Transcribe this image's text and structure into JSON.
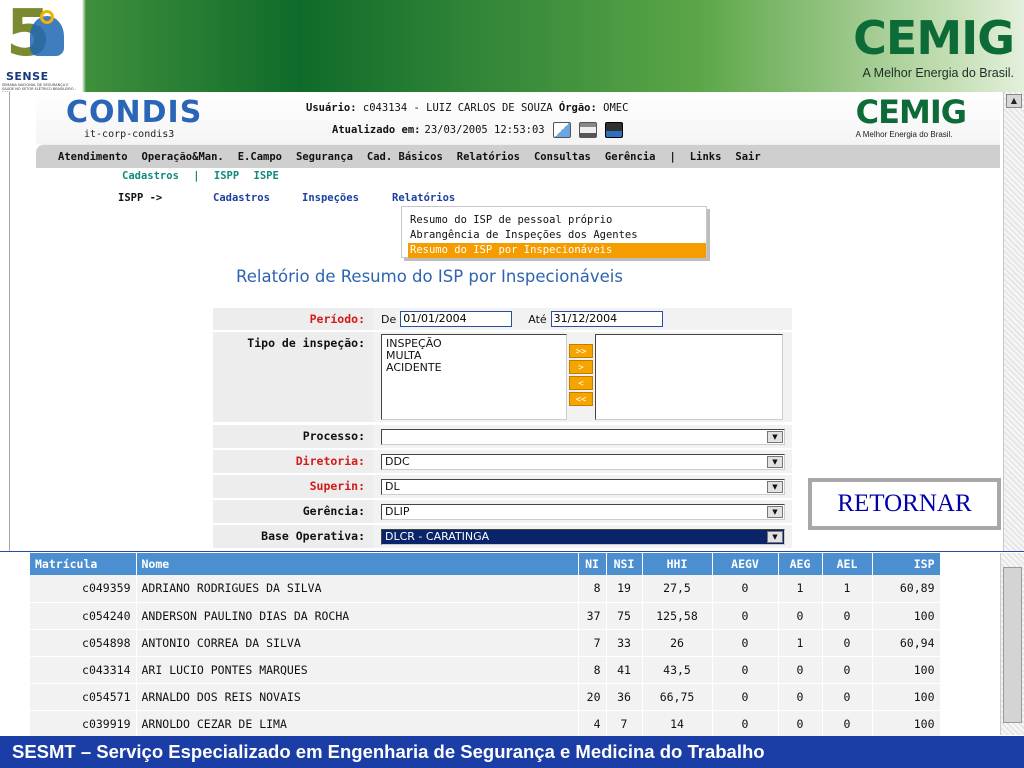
{
  "slide": {
    "logo_word": "SENSE",
    "logo_number": "5",
    "logo_tagline": "SEMANA NACIONAL DE SEGURANÇA E SAÚDE NO SETOR ELÉTRICO BRASILEIRO - 2006",
    "cemig_brand": "CEMIG",
    "cemig_slogan": "A Melhor Energia do Brasil.",
    "footer": "SESMT – Serviço Especializado em Engenharia de Segurança e Medicina do Trabalho"
  },
  "app": {
    "logo": "CONDIS",
    "host": "it-corp-condis3",
    "user_label": "Usuário:",
    "user_value": "c043134 - LUIZ CARLOS DE SOUZA",
    "org_label": "Órgão:",
    "org_value": "OMEC",
    "updated_label": "Atualizado em:",
    "updated_value": "23/03/2005 12:53:03",
    "cemig_brand": "CEMIG",
    "cemig_slogan": "A Melhor Energia do Brasil.",
    "main_menu": [
      "Atendimento",
      "Operação&Man.",
      "E.Campo",
      "Segurança",
      "Cad. Básicos",
      "Relatórios",
      "Consultas",
      "Gerência",
      "|",
      "Links",
      "Sair"
    ],
    "submenu1": [
      "Cadastros",
      "|",
      "ISPP",
      "ISPE"
    ],
    "crumb": "ISPP ->",
    "submenu2": [
      "Cadastros",
      "Inspeções",
      "Relatórios"
    ],
    "dropdown": [
      "Resumo do ISP de pessoal próprio",
      "Abrangência de Inspeções dos Agentes",
      "Resumo do ISP por Inspecionáveis"
    ],
    "report_title": "Relatório de Resumo do ISP por Inspecionáveis",
    "form": {
      "periodo_label": "Período:",
      "de_label": "De",
      "de_value": "01/01/2004",
      "ate_label": "Até",
      "ate_value": "31/12/2004",
      "tipo_label": "Tipo de inspeção:",
      "tipo_options": [
        "INSPEÇÃO",
        "MULTA",
        "ACIDENTE"
      ],
      "move_buttons": [
        ">>",
        ">",
        "<",
        "<<"
      ],
      "processo_label": "Processo:",
      "processo_value": "",
      "diretoria_label": "Diretoria:",
      "diretoria_value": "DDC",
      "superin_label": "Superin:",
      "superin_value": "DL",
      "gerencia_label": "Gerência:",
      "gerencia_value": "DLIP",
      "base_label": "Base Operativa:",
      "base_value": "DLCR - CARATINGA"
    },
    "retornar": "RETORNAR",
    "table": {
      "headers": [
        "Matrícula",
        "Nome",
        "NI",
        "NSI",
        "HHI",
        "AEGV",
        "AEG",
        "AEL",
        "ISP"
      ],
      "rows": [
        [
          "c049359",
          "ADRIANO RODRIGUES DA SILVA",
          "8",
          "19",
          "27,5",
          "0",
          "1",
          "1",
          "60,89"
        ],
        [
          "c054240",
          "ANDERSON PAULINO DIAS DA ROCHA",
          "37",
          "75",
          "125,58",
          "0",
          "0",
          "0",
          "100"
        ],
        [
          "c054898",
          "ANTONIO CORREA DA SILVA",
          "7",
          "33",
          "26",
          "0",
          "1",
          "0",
          "60,94"
        ],
        [
          "c043314",
          "ARI LUCIO PONTES MARQUES",
          "8",
          "41",
          "43,5",
          "0",
          "0",
          "0",
          "100"
        ],
        [
          "c054571",
          "ARNALDO DOS REIS NOVAIS",
          "20",
          "36",
          "66,75",
          "0",
          "0",
          "0",
          "100"
        ],
        [
          "c039919",
          "ARNOLDO CEZAR DE LIMA",
          "4",
          "7",
          "14",
          "0",
          "0",
          "0",
          "100"
        ]
      ]
    }
  },
  "colors": {
    "footer_bg": "#1a3ea6",
    "header_green": "#0f6b2a",
    "table_header": "#4b8fd0",
    "menu_accent": "#f59d00",
    "label_red": "#d11a1a"
  }
}
